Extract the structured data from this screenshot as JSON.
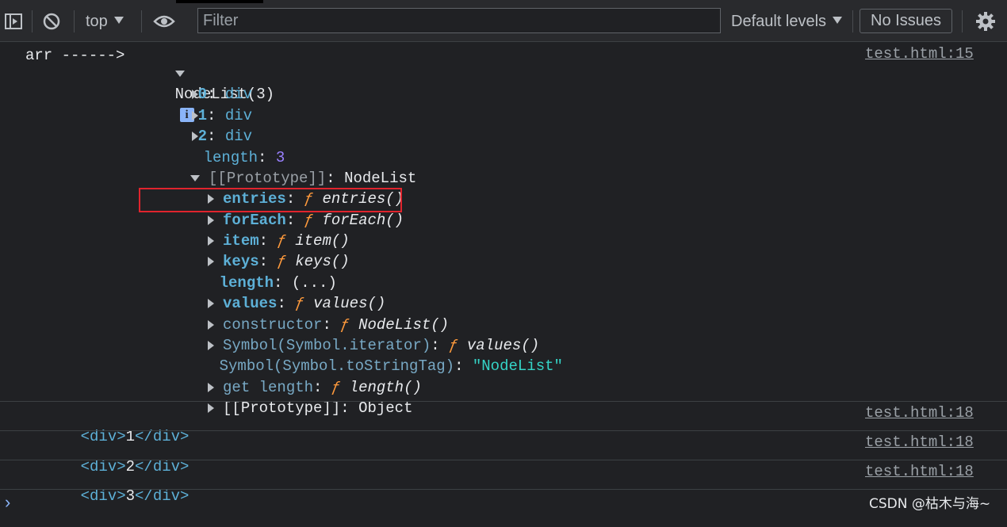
{
  "toolbar": {
    "context": "top",
    "filter_placeholder": "Filter",
    "levels": "Default levels",
    "issues": "No Issues"
  },
  "log1": {
    "label": "arr ------>",
    "object_label": "NodeList(3)",
    "info": "i",
    "source": "test.html:15",
    "entries": [
      {
        "key": "0",
        "sep": ": ",
        "value": "div"
      },
      {
        "key": "1",
        "sep": ": ",
        "value": "div"
      },
      {
        "key": "2",
        "sep": ": ",
        "value": "div"
      }
    ],
    "length": {
      "key": "length",
      "sep": ": ",
      "value": "3"
    },
    "prototype": {
      "key": "[[Prototype]]",
      "sep": ": ",
      "value": "NodeList"
    },
    "proto_members": [
      {
        "key": "entries",
        "sep": ": ",
        "f": "ƒ",
        "fn": "entries()"
      },
      {
        "key": "forEach",
        "sep": ": ",
        "f": "ƒ",
        "fn": "forEach()"
      },
      {
        "key": "item",
        "sep": ": ",
        "f": "ƒ",
        "fn": "item()"
      },
      {
        "key": "keys",
        "sep": ": ",
        "f": "ƒ",
        "fn": "keys()"
      },
      {
        "key": "length",
        "sep": ": ",
        "value": "(...)"
      },
      {
        "key": "values",
        "sep": ": ",
        "f": "ƒ",
        "fn": "values()"
      },
      {
        "key": "constructor",
        "sep": ": ",
        "f": "ƒ",
        "fn": "NodeList()"
      },
      {
        "key": "Symbol(Symbol.iterator)",
        "sep": ": ",
        "f": "ƒ",
        "fn": "values()"
      },
      {
        "key": "Symbol(Symbol.toStringTag)",
        "sep": ": ",
        "value": "\"NodeList\""
      },
      {
        "key": "get length",
        "sep": ": ",
        "f": "ƒ",
        "fn": "length()"
      },
      {
        "key": "[[Prototype]]",
        "sep": ": ",
        "value": "Object"
      }
    ]
  },
  "logs": [
    {
      "open": "<div>",
      "text": "1",
      "close": "</div>",
      "source": "test.html:18"
    },
    {
      "open": "<div>",
      "text": "2",
      "close": "</div>",
      "source": "test.html:18"
    },
    {
      "open": "<div>",
      "text": "3",
      "close": "</div>",
      "source": "test.html:18"
    }
  ],
  "prompt": "›",
  "watermark": "CSDN @枯木与海~"
}
